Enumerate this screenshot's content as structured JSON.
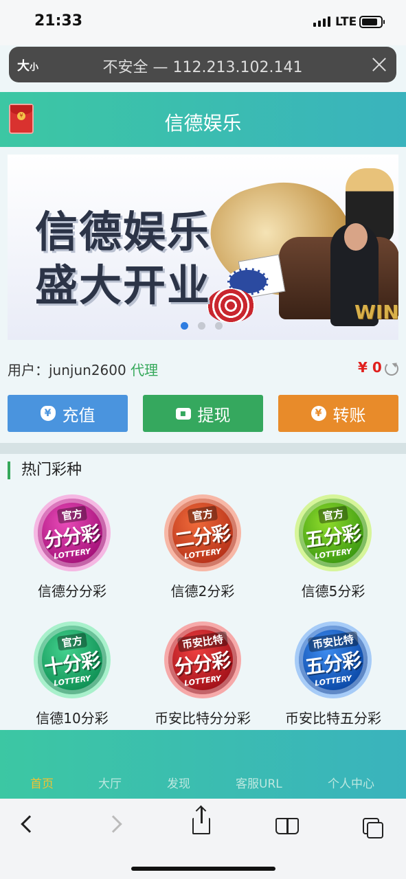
{
  "status_bar": {
    "time": "21:33",
    "network": "LTE"
  },
  "url_bar": {
    "text_size": "大",
    "text_size_small": "小",
    "address": "不安全 — 112.213.102.141"
  },
  "header": {
    "title": "信德娱乐",
    "redpacket_symbol": "¥"
  },
  "banner": {
    "line1": "信德娱乐",
    "line2": "盛大开业",
    "badge": "WIN",
    "slides": 3,
    "active_slide": 0
  },
  "user": {
    "label": "用户：",
    "username": "junjun2600",
    "role": "代理",
    "balance": "¥ 0"
  },
  "actions": [
    {
      "label": "充值",
      "icon": "money-bag-icon",
      "glyph": "¥"
    },
    {
      "label": "提现",
      "icon": "wallet-icon",
      "glyph": "▪"
    },
    {
      "label": "转账",
      "icon": "yen-coin-icon",
      "glyph": "¥"
    }
  ],
  "section": {
    "title": "热门彩种"
  },
  "games": [
    {
      "name": "信德分分彩",
      "badge": "官方",
      "logo_text": "分分彩",
      "lottery": "LOTTERY"
    },
    {
      "name": "信德2分彩",
      "badge": "官方",
      "logo_text": "二分彩",
      "lottery": "LOTTERY"
    },
    {
      "name": "信德5分彩",
      "badge": "官方",
      "logo_text": "五分彩",
      "lottery": "LOTTERY"
    },
    {
      "name": "信德10分彩",
      "badge": "官方",
      "logo_text": "十分彩",
      "lottery": "LOTTERY"
    },
    {
      "name": "币安比特分分彩",
      "badge": "币安比特",
      "logo_text": "分分彩",
      "lottery": "LOTTERY"
    },
    {
      "name": "币安比特五分彩",
      "badge": "币安比特",
      "logo_text": "五分彩",
      "lottery": "LOTTERY"
    }
  ],
  "tabbar": [
    {
      "label": "首页",
      "active": true
    },
    {
      "label": "大厅",
      "active": false
    },
    {
      "label": "发现",
      "active": false
    },
    {
      "label": "客服URL",
      "active": false
    },
    {
      "label": "个人中心",
      "active": false
    }
  ],
  "colors": {
    "header_start": "#3cc7a3",
    "header_end": "#3ab3bd",
    "recharge": "#4a94de",
    "withdraw": "#35a85e",
    "transfer": "#e88b2a",
    "balance": "#e0201e",
    "tab_active": "#f1c232",
    "role": "#35a85a"
  }
}
